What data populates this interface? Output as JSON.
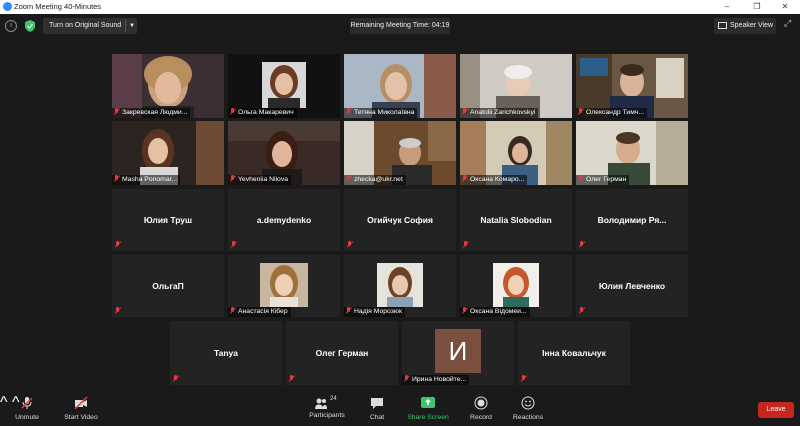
{
  "window": {
    "title": "Zoom Meeting 40-Minutes",
    "controls": [
      "–",
      "❐",
      "✕"
    ]
  },
  "topbar": {
    "original_sound": "Turn on Original Sound",
    "timer": "Remaining Meeting Time: 04:19",
    "speaker_view": "Speaker View"
  },
  "participants": [
    {
      "name": "Закревская Людми...",
      "type": "video"
    },
    {
      "name": "Ольга Макаревич",
      "type": "video"
    },
    {
      "name": "Тетяна Миколаївна",
      "type": "video"
    },
    {
      "name": "Anatolii Zarichkovskyi",
      "type": "video"
    },
    {
      "name": "Олександр Тимч...",
      "type": "video"
    },
    {
      "name": "Masha Ponomar...",
      "type": "video"
    },
    {
      "name": "Yevheniia Nilova",
      "type": "video",
      "active": true
    },
    {
      "name": "zhecka@ukr.net",
      "type": "video"
    },
    {
      "name": "Оксана Комаро...",
      "type": "video"
    },
    {
      "name": "Олег Герман",
      "type": "video"
    },
    {
      "name": "Юлия Труш",
      "type": "name"
    },
    {
      "name": "a.demydenko",
      "type": "name"
    },
    {
      "name": "Огийчук София",
      "type": "name"
    },
    {
      "name": "Natalia Slobodian",
      "type": "name"
    },
    {
      "name": "Володимир  Ря...",
      "type": "name"
    },
    {
      "name": "ОльгаП",
      "type": "name"
    },
    {
      "name": "Анастасія Кібер",
      "type": "photo"
    },
    {
      "name": "Надія Морозюк",
      "type": "photo"
    },
    {
      "name": "Оксана Відомеи...",
      "type": "photo"
    },
    {
      "name": "Юлия Левченко",
      "type": "name"
    },
    {
      "name": "Tanya",
      "type": "name"
    },
    {
      "name": "Олег Герман",
      "type": "name"
    },
    {
      "name": "Ирина Новойте...",
      "type": "avatar",
      "initial": "И"
    },
    {
      "name": "Інна Ковальчук",
      "type": "name"
    }
  ],
  "toolbar": {
    "unmute": "Unmute",
    "start_video": "Start Video",
    "participants": "Participants",
    "participant_count": "24",
    "chat": "Chat",
    "share_screen": "Share Screen",
    "record": "Record",
    "reactions": "Reactions",
    "leave": "Leave"
  },
  "colors": {
    "accent_green": "#3ec46d",
    "leave_red": "#c9251f",
    "active_border": "#c9e34b",
    "muted_red": "#e8383d",
    "avatar_bg": "#7a4f3f"
  }
}
